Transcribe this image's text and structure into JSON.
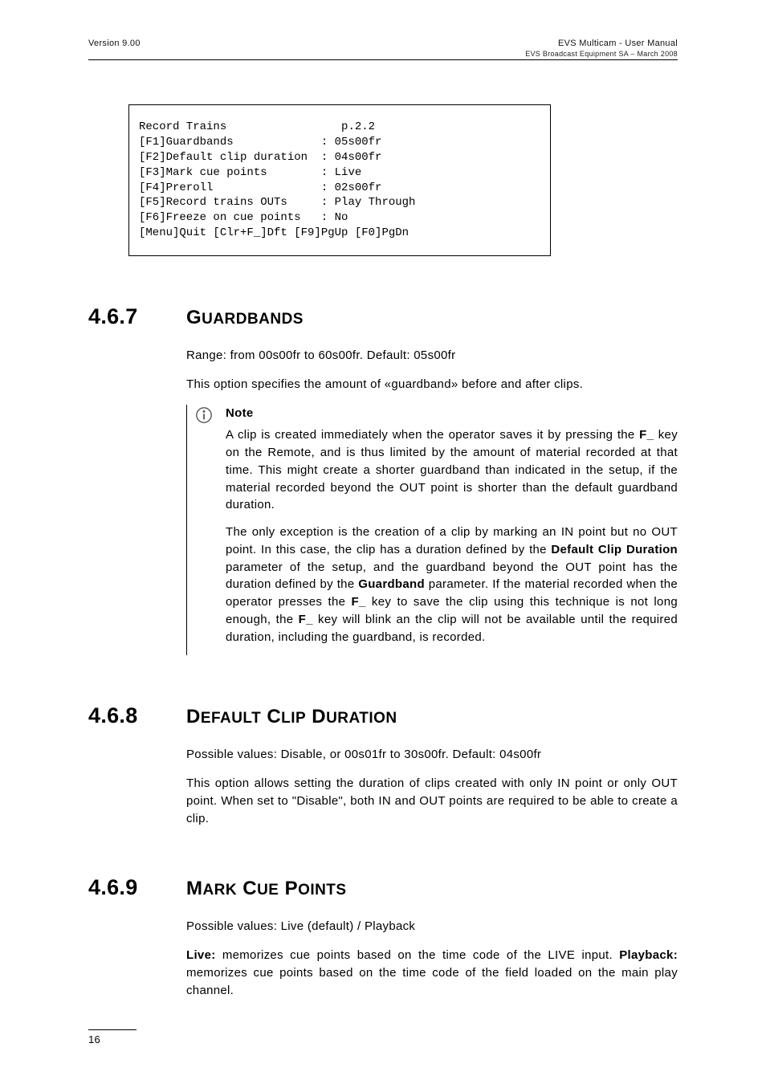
{
  "header": {
    "left": "Version 9.00",
    "right_top": "EVS Multicam - User Manual",
    "right_sub": "EVS Broadcast Equipment SA – March 2008"
  },
  "code": {
    "l1": "Record Trains                 p.2.2",
    "l2": "[F1]Guardbands             : 05s00fr",
    "l3": "[F2]Default clip duration  : 04s00fr",
    "l4": "[F3]Mark cue points        : Live",
    "l5": "[F4]Preroll                : 02s00fr",
    "l6": "[F5]Record trains OUTs     : Play Through",
    "l7": "[F6]Freeze on cue points   : No",
    "l8": "[Menu]Quit [Clr+F_]Dft [F9]PgUp [F0]PgDn"
  },
  "s1": {
    "num": "4.6.7",
    "title_main": "G",
    "title_rest": "UARDBANDS",
    "range": "Range: from 00s00fr to 60s00fr. Default: 05s00fr",
    "intro": "This option specifies the amount of «guardband» before and after clips.",
    "note_label": "Note",
    "note_p1a": "A clip is created immediately when the operator saves it by pressing the ",
    "note_p1_key": "F_",
    "note_p1b": " key on the Remote, and is thus limited by the amount of material recorded at that time. This might create a shorter guardband than indicated in the setup, if the material recorded beyond the OUT point is shorter than the default guardband duration.",
    "note_p2a": "The only exception is the creation of a clip by marking an IN point but no OUT point. In this case, the clip has a duration defined by the ",
    "note_p2_b1": "Default Clip Duration",
    "note_p2b": " parameter of the setup, and the guardband beyond the OUT point has the duration defined by the ",
    "note_p2_b2": "Guardband",
    "note_p2c": " parameter. If the material recorded when the operator presses the ",
    "note_p2_key1": "F_",
    "note_p2d": " key to save the clip using this technique is not long enough, the ",
    "note_p2_key2": "F_",
    "note_p2e": " key will blink an the clip will not be available until the required duration, including the guardband, is recorded."
  },
  "s2": {
    "num": "4.6.8",
    "title_w1_main": "D",
    "title_w1_rest": "EFAULT",
    "title_w2_main": "C",
    "title_w2_rest": "LIP",
    "title_w3_main": "D",
    "title_w3_rest": "URATION",
    "line1": "Possible values: Disable, or 00s01fr to 30s00fr. Default: 04s00fr",
    "line2": "This option allows setting the duration of clips created with only IN point or only OUT point. When set to \"Disable\", both IN and OUT points are required to be able to create a clip."
  },
  "s3": {
    "num": "4.6.9",
    "title_w1_main": "M",
    "title_w1_rest": "ARK",
    "title_w2_main": "C",
    "title_w2_rest": "UE",
    "title_w3_main": "P",
    "title_w3_rest": "OINTS",
    "line1": "Possible values: Live (default) / Playback",
    "p2_b1": "Live:",
    "p2_a": " memorizes cue points based on the time code of the LIVE input. ",
    "p2_b2": "Playback:",
    "p2_b": " memorizes cue points based on the time code of the field loaded on the main play channel."
  },
  "footer": {
    "page": "16"
  }
}
